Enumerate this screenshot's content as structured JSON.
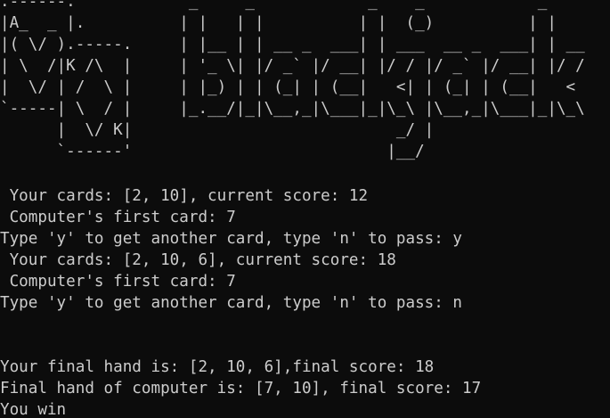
{
  "terminal": {
    "art": [
      ".------.            _     _            _    _            _    ",
      "|A_  _ |.          | |   | |          | |  (_)          | |   ",
      "|( \\/ ).-----.     | |__ | | __ _  ___| | ___  __ _  ___| | __",
      "| \\  /|K /\\  |     | '_ \\| |/ _` |/ __| |/ / |/ _` |/ __| |/ /",
      "|  \\/ | /  \\ |     | |_) | | (_| | (__|   <| | (_| | (__|   < ",
      "`-----| \\  / |     |_.__/|_|\\__,_|\\___|_|\\_\\ |\\__,_|\\___|_|\\_\\",
      "      |  \\/ K|                            _/ |                ",
      "      `------'                           |__/                 "
    ],
    "lines": [
      " Your cards: [2, 10], current score: 12",
      " Computer's first card: 7",
      "Type 'y' to get another card, type 'n' to pass: y",
      " Your cards: [2, 10, 6], current score: 18",
      " Computer's first card: 7",
      "Type 'y' to get another card, type 'n' to pass: n",
      "",
      "",
      "Your final hand is: [2, 10, 6],final score: 18",
      "Final hand of computer is: [7, 10], final score: 17",
      "You win"
    ]
  }
}
